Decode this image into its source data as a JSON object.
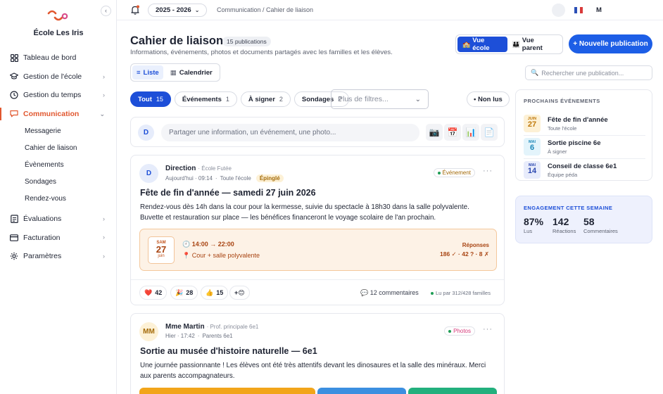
{
  "school": {
    "name": "École Les Iris"
  },
  "colors": {
    "accent": "#e1572f",
    "primary": "#1d4fd8"
  },
  "nav": {
    "items": [
      {
        "label": "Tableau de bord",
        "icon": "grid-icon"
      },
      {
        "label": "Gestion de l'école",
        "icon": "graduation-cap-icon"
      },
      {
        "label": "Gestion du temps",
        "icon": "clock-icon"
      },
      {
        "label": "Communication",
        "icon": "chat-icon"
      },
      {
        "label": "Évaluations",
        "icon": "clipboard-icon"
      },
      {
        "label": "Facturation",
        "icon": "card-icon"
      },
      {
        "label": "Paramètres",
        "icon": "gear-icon"
      }
    ],
    "sub_items": [
      "Messagerie",
      "Cahier de liaison",
      "Évènements",
      "Sondages",
      "Rendez-vous"
    ]
  },
  "topbar": {
    "year": "2025 - 2026",
    "breadcrumb": "Communication / Cahier de liaison",
    "user_initial": "M"
  },
  "header": {
    "title": "Cahier de liaison",
    "count": "15 publications",
    "subtitle": "Informations, événements, photos et documents partagés avec les familles et les élèves.",
    "view_school": "Vue école",
    "view_parent": "Vue parent",
    "new_publication": "+ Nouvelle publication"
  },
  "toolbar": {
    "list_label": "Liste",
    "calendar_label": "Calendrier",
    "search_placeholder": "Rechercher une publication..."
  },
  "filters": {
    "chips": [
      {
        "label": "Tout",
        "count": "15"
      },
      {
        "label": "Événements",
        "count": "1"
      },
      {
        "label": "À signer",
        "count": "2"
      },
      {
        "label": "Sondages",
        "count": "2"
      }
    ],
    "more_placeholder": "Plus de filtres...",
    "unread": "• Non lus"
  },
  "composer": {
    "avatar": "D",
    "placeholder": "Partager une information, un événement, une photo..."
  },
  "posts": [
    {
      "avatar": "D",
      "author": "Direction",
      "role": "· École Futée",
      "time": "Aujourd'hui · 09:14",
      "audience": "Toute l'école",
      "pinned": "Épinglé",
      "type": "Événement",
      "title": "Fête de fin d'année — samedi 27 juin 2026",
      "body": "Rendez-vous dès 14h dans la cour pour la kermesse, suivie du spectacle à 18h30 dans la salle polyvalente. Buvette et restauration sur place — les bénéfices financeront le voyage scolaire de l'an prochain.",
      "event": {
        "day_name": "SAM",
        "day": "27",
        "month": "juin",
        "time": "🕘 14:00 → 22:00",
        "place": "📍 Cour + salle polyvalente",
        "responses_label": "Réponses",
        "responses": "186 ✓ · 42 ? · 8 ✗"
      },
      "reactions": [
        {
          "emoji": "❤️",
          "count": "42"
        },
        {
          "emoji": "🎉",
          "count": "28"
        },
        {
          "emoji": "👍",
          "count": "15"
        },
        {
          "emoji": "+😊",
          "count": ""
        }
      ],
      "comments": "💬 12 commentaires",
      "read_by": "Lu par 312/428 familles"
    },
    {
      "avatar": "MM",
      "author": "Mme Martin",
      "role": "· Prof. principale 6e1",
      "time": "Hier · 17:42",
      "audience": "Parents 6e1",
      "type": "Photos",
      "title": "Sortie au musée d'histoire naturelle — 6e1",
      "body": "Une journée passionnante ! Les élèves ont été très attentifs devant les dinosaures et la salle des minéraux. Merci aux parents accompagnateurs."
    }
  ],
  "upcoming": {
    "title": "PROCHAINS ÉVÉNEMENTS",
    "items": [
      {
        "month": "JUIN",
        "day": "27",
        "name": "Fête de fin d'année",
        "sub": "Toute l'école"
      },
      {
        "month": "MAI",
        "day": "6",
        "name": "Sortie piscine 6e",
        "sub": "À signer"
      },
      {
        "month": "MAI",
        "day": "14",
        "name": "Conseil de classe 6e1",
        "sub": "Équipe péda"
      }
    ]
  },
  "engagement": {
    "title": "ENGAGEMENT CETTE SEMAINE",
    "stats": [
      {
        "value": "87%",
        "label": "Lus"
      },
      {
        "value": "142",
        "label": "Réactions"
      },
      {
        "value": "58",
        "label": "Commentaires"
      }
    ]
  }
}
